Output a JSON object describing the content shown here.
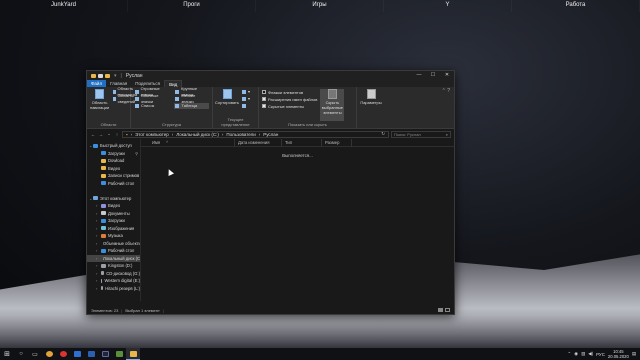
{
  "desktop": {
    "folders": [
      "JunkYard",
      "Проги",
      "Игры",
      "Y",
      "Работа"
    ]
  },
  "window": {
    "title": "Руслан",
    "tabs": [
      "Файл",
      "Главная",
      "Поделиться",
      "Вид"
    ],
    "ribbon": {
      "panels": {
        "nav_pane": "Область навигации",
        "details_pane": "Область сведений",
        "label": "Области"
      },
      "layout": {
        "items": [
          "Огромные значки",
          "Крупные значки",
          "Обычные значки",
          "Мелкие значки",
          "Список",
          "Таблица"
        ],
        "label": "Структура"
      },
      "current_view": {
        "sort": "Сортировать",
        "label": "Текущее представление"
      },
      "show_hide": {
        "item_checkboxes": "Флажки элементов",
        "extensions": "Расширения имен файлов",
        "hidden_items": "Скрытые элементы",
        "hide_selected": "Скрыть выбранные элементы",
        "label": "Показать или скрыть"
      },
      "options": "Параметры"
    },
    "address": {
      "path": [
        "Этот компьютер",
        "Локальный диск (C:)",
        "Пользователи",
        "Руслан"
      ],
      "search_placeholder": "Поиск: Руслан"
    },
    "nav": [
      {
        "label": "Быстрый доступ",
        "level": 1,
        "color": "#3b8fe0",
        "caret": "v"
      },
      {
        "label": "Загрузки",
        "level": 2,
        "color": "#3b8fe0",
        "pin": true
      },
      {
        "label": "Dowload",
        "level": 2,
        "color": "#e8b949"
      },
      {
        "label": "Видео",
        "level": 2,
        "color": "#e8b949"
      },
      {
        "label": "Записи стримов",
        "level": 2,
        "color": "#e8b949"
      },
      {
        "label": "Рабочий стол",
        "level": 2,
        "color": "#3b8fe0"
      },
      {
        "label": "",
        "level": 2,
        "color": ""
      },
      {
        "label": "Этот компьютер",
        "level": 1,
        "color": "#6fa5dd",
        "caret": "v"
      },
      {
        "label": "Видео",
        "level": 2,
        "color": "#8f8fdc",
        "caret": ">"
      },
      {
        "label": "Документы",
        "level": 2,
        "color": "#c9c9c9",
        "caret": ">"
      },
      {
        "label": "Загрузки",
        "level": 2,
        "color": "#3b8fe0",
        "caret": ">"
      },
      {
        "label": "Изображения",
        "level": 2,
        "color": "#6fbfd9",
        "caret": ">"
      },
      {
        "label": "Музыка",
        "level": 2,
        "color": "#e07b3b",
        "caret": ">"
      },
      {
        "label": "Объемные объекты",
        "level": 2,
        "color": "#6fa5dd",
        "caret": ">"
      },
      {
        "label": "Рабочий стол",
        "level": 2,
        "color": "#3b8fe0",
        "caret": ">"
      },
      {
        "label": "Локальный диск (C:)",
        "level": 2,
        "color": "#9aa0a8",
        "caret": ">",
        "selected": true
      },
      {
        "label": "Kingston (D:)",
        "level": 2,
        "color": "#9aa0a8",
        "caret": ">"
      },
      {
        "label": "CD-дисковод (G:)",
        "level": 2,
        "color": "#9aa0a8",
        "caret": ">"
      },
      {
        "label": "Western digital (E:)",
        "level": 2,
        "color": "#9aa0a8",
        "caret": ">"
      },
      {
        "label": "Hitachi резерв (L:)",
        "level": 2,
        "color": "#9aa0a8",
        "caret": ">"
      },
      {
        "label": "",
        "level": 2,
        "color": ""
      },
      {
        "label": "Сеть",
        "level": 1,
        "color": "#6fa5dd",
        "caret": ">"
      }
    ],
    "columns": [
      "Имя",
      "Дата изменения",
      "Тип",
      "Размер"
    ],
    "loading_text": "Выполняется...",
    "status": {
      "count": "Элементов: 23",
      "selected": "Выбран 1 элемент"
    }
  },
  "tray": {
    "lang": "РУС",
    "time": "10:45",
    "date": "20.05.2020"
  }
}
